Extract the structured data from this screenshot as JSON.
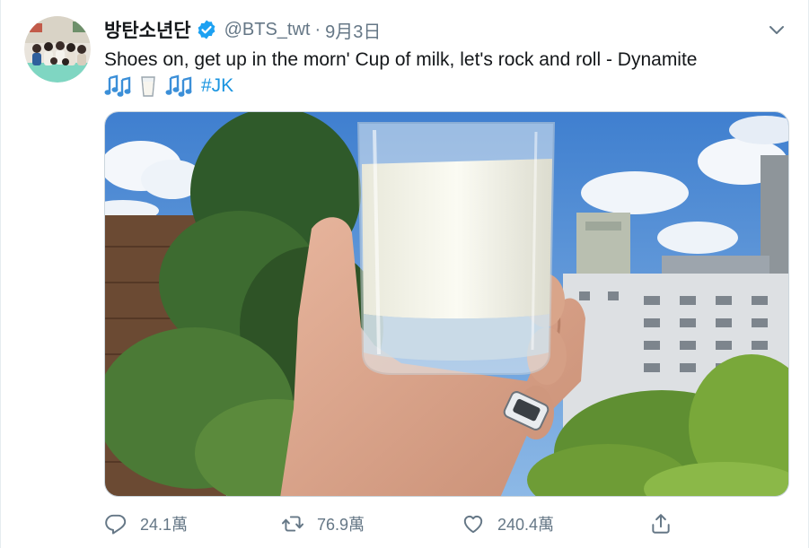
{
  "tweet": {
    "display_name": "방탄소년단",
    "verified": true,
    "verified_icon": "verified-badge-icon",
    "handle": "@BTS_twt",
    "separator": "·",
    "date": "9月3日",
    "caret_icon": "chevron-down-icon",
    "text_line1": "Shoes on, get up in the morn' Cup of milk, let's rock and roll - Dynamite",
    "emojis": [
      "musical-notes-icon",
      "milk-glass-icon",
      "musical-notes-icon"
    ],
    "hashtag": "#JK",
    "media_icon": "milk-glass-photo"
  },
  "actions": {
    "reply": {
      "icon": "reply-icon",
      "count": "24.1萬"
    },
    "retweet": {
      "icon": "retweet-icon",
      "count": "76.9萬"
    },
    "like": {
      "icon": "heart-icon",
      "count": "240.4萬"
    },
    "share": {
      "icon": "share-icon"
    }
  },
  "colors": {
    "accent": "#1b95e0",
    "secondary_text": "#657786",
    "verified": "#1da1f2"
  }
}
